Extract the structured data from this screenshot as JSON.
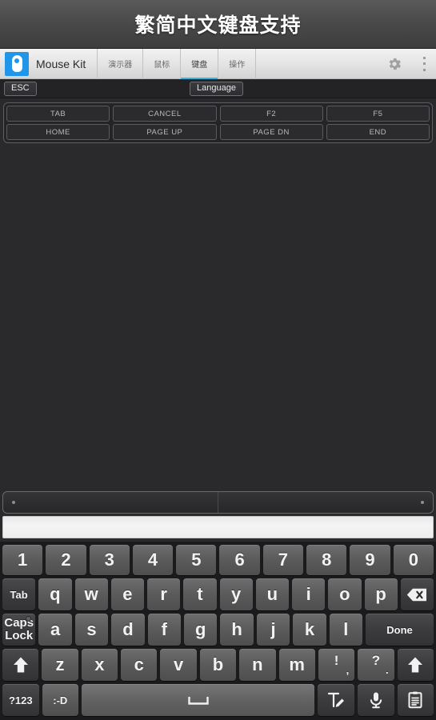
{
  "banner": {
    "title": "繁简中文键盘支持"
  },
  "actionbar": {
    "app_name": "Mouse Kit",
    "logo_icon": "mouse-logo-icon",
    "accent_color": "#2bb8e8",
    "logo_color": "#2196e8",
    "tabs": [
      {
        "label": "演示器",
        "active": false
      },
      {
        "label": "鼠标",
        "active": false
      },
      {
        "label": "键盘",
        "active": true
      },
      {
        "label": "操作",
        "active": false
      }
    ],
    "settings_icon": "gear-icon",
    "overflow_icon": "overflow-menu-icon"
  },
  "toolrow": {
    "esc_label": "ESC",
    "language_label": "Language"
  },
  "function_keys": {
    "row1": [
      "TAB",
      "CANCEL",
      "F2",
      "F5"
    ],
    "row2": [
      "HOME",
      "PAGE UP",
      "PAGE DN",
      "END"
    ]
  },
  "input": {
    "text_value": "",
    "placeholder": ""
  },
  "keyboard": {
    "row_numbers": [
      "1",
      "2",
      "3",
      "4",
      "5",
      "6",
      "7",
      "8",
      "9",
      "0"
    ],
    "row_top": {
      "tab_label": "Tab",
      "letters": [
        "q",
        "w",
        "e",
        "r",
        "t",
        "y",
        "u",
        "i",
        "o",
        "p"
      ],
      "backspace_icon": "backspace-icon"
    },
    "row_home": {
      "caps_line1": "Caps",
      "caps_line2": "Lock",
      "letters": [
        "a",
        "s",
        "d",
        "f",
        "g",
        "h",
        "j",
        "k",
        "l"
      ],
      "done_label": "Done"
    },
    "row_shift": {
      "shift_left_icon": "shift-icon",
      "letters": [
        "z",
        "x",
        "c",
        "v",
        "b",
        "n",
        "m"
      ],
      "punct1_main": "!",
      "punct1_sub": ",",
      "punct2_main": "?",
      "punct2_sub": ".",
      "shift_right_icon": "shift-icon"
    },
    "row_bottom": {
      "symbols_label": "?123",
      "emoji_label": ":-D",
      "space_icon": "space-icon",
      "handwriting_icon": "handwriting-icon",
      "mic_icon": "microphone-icon",
      "clipboard_icon": "clipboard-icon"
    }
  }
}
